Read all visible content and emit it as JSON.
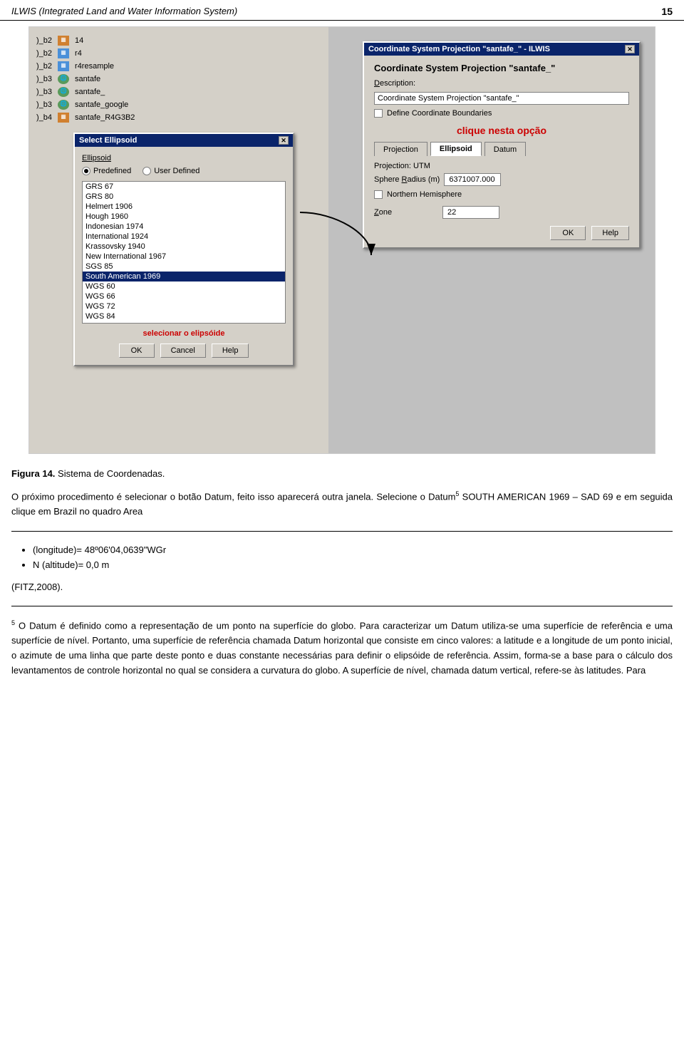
{
  "header": {
    "title": "ILWIS (Integrated Land and Water Information System)",
    "page_number": "15"
  },
  "screenshot": {
    "file_list": {
      "items": [
        {
          "name": "_b2",
          "icon": "orange",
          "file": "14"
        },
        {
          "name": "_b2",
          "icon": "blue",
          "file": "r4"
        },
        {
          "name": "_b2",
          "icon": "blue",
          "file": "r4resample"
        },
        {
          "name": "_b3",
          "icon": "globe",
          "file": "santafe"
        },
        {
          "name": "_b3",
          "icon": "globe",
          "file": "santafe_"
        },
        {
          "name": "_b3",
          "icon": "globe",
          "file": "santafe_google"
        },
        {
          "name": "_b4",
          "icon": "orange",
          "file": "santafe_R4G3B2"
        }
      ]
    },
    "ellipsoid_dialog": {
      "title": "Select Ellipsoid",
      "label": "Ellipsoid",
      "radio_predefined": "Predefined",
      "radio_user_defined": "User Defined",
      "list_items": [
        "GRS 67",
        "GRS 80",
        "Helmert 1906",
        "Hough 1960",
        "Indonesian 1974",
        "International 1924",
        "Krassovsky 1940",
        "New International 1967",
        "SGS 85",
        "South American 1969",
        "WGS 60",
        "WGS 66",
        "WGS 72",
        "WGS 84"
      ],
      "selected_item": "South American 1969",
      "annotation": "selecionar o elipsóide",
      "buttons": [
        "OK",
        "Cancel",
        "Help"
      ]
    },
    "coord_dialog": {
      "title_bar": "Coordinate System Projection \"santafe_\" - ILWIS",
      "heading": "Coordinate System Projection \"santafe_\"",
      "description_label": "Description:",
      "description_value": "Coordinate System Projection \"santafe_\"",
      "checkbox_label": "Define Coordinate Boundaries",
      "annotation": "clique nesta opção",
      "tabs": [
        "Projection",
        "Ellipsoid",
        "Datum"
      ],
      "active_tab": "Ellipsoid",
      "proj_label": "Projection: UTM",
      "sphere_radius_label": "Sphere Radius (m)",
      "sphere_radius_value": "6371007.000",
      "northern_hemisphere_label": "Northern Hemisphere",
      "zone_label": "Zone",
      "zone_value": "22",
      "buttons": [
        "OK",
        "Help"
      ]
    }
  },
  "figure_caption": "Figura 14. Sistema de Coordenadas.",
  "paragraphs": [
    "O próximo procedimento é selecionar o botão Datum, feito isso aparecerá outra janela. Selecione o Datum⁵ SOUTH AMERICAN 1969 – SAD 69 e em seguida clique em Brazil no quadro Area",
    "(longitude)= 48º06'04,0639\"WGr",
    "N (altitude)= 0,0 m",
    "(FITZ,2008).",
    "⁵ O Datum é definido como a representação de um ponto na superfície do globo. Para caracterizar um Datum utiliza-se uma superfície de referência e uma superfície de nível. Portanto, uma superfície de referência chamada Datum horizontal que consiste em cinco valores: a latitude e a longitude de um ponto inicial, o azimute de uma linha que parte deste ponto e duas constante necessárias para definir o elipsóide de referência. Assim, forma-se a base para o cálculo dos levantamentos de controle horizontal no qual se considera a curvatura do globo. A superfície de nível, chamada datum vertical, refere-se às latitudes. Para"
  ]
}
